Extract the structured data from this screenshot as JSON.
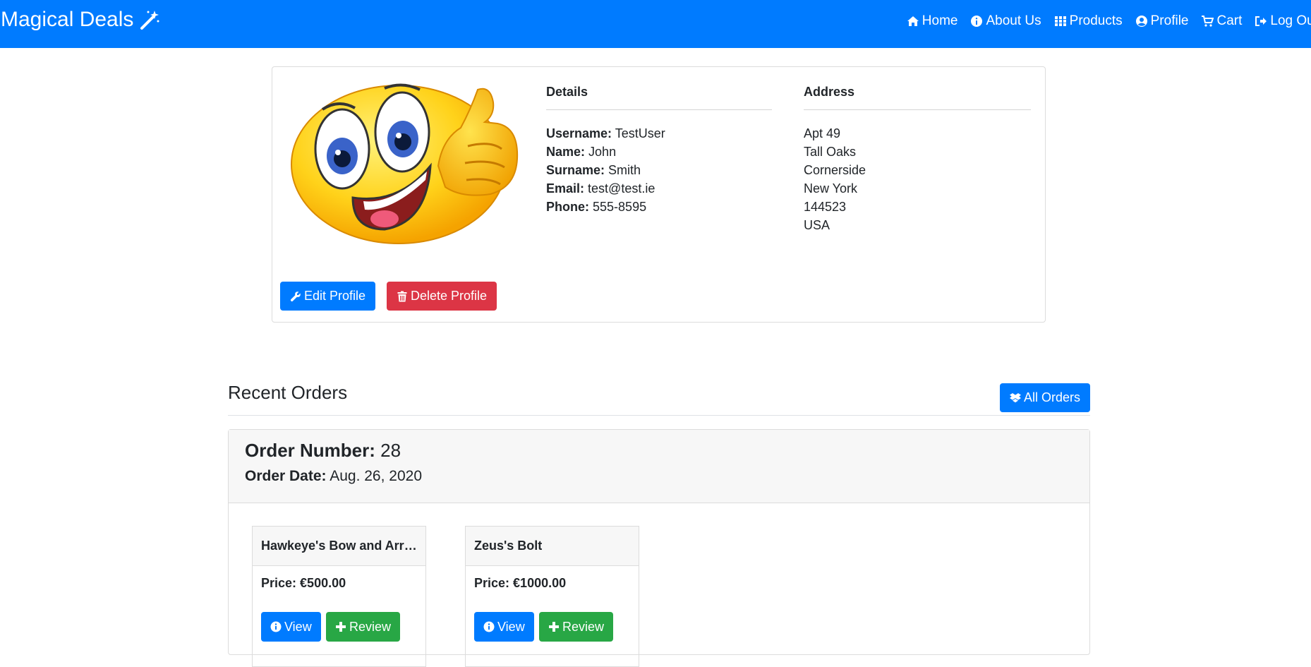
{
  "navbar": {
    "brand": "Magical Deals",
    "links": [
      {
        "label": "Home",
        "icon": "home-icon"
      },
      {
        "label": "About Us",
        "icon": "info-icon"
      },
      {
        "label": "Products",
        "icon": "grid-icon"
      },
      {
        "label": "Profile",
        "icon": "user-circle-icon"
      },
      {
        "label": "Cart",
        "icon": "cart-icon"
      },
      {
        "label": "Log Out",
        "icon": "logout-icon"
      }
    ]
  },
  "profile": {
    "details_title": "Details",
    "address_title": "Address",
    "details": [
      {
        "label": "Username:",
        "value": "TestUser"
      },
      {
        "label": "Name:",
        "value": "John"
      },
      {
        "label": "Surname:",
        "value": "Smith"
      },
      {
        "label": "Email:",
        "value": "test@test.ie"
      },
      {
        "label": "Phone:",
        "value": "555-8595"
      }
    ],
    "address_lines": [
      "Apt 49",
      "Tall Oaks",
      "Cornerside",
      "New York",
      "144523",
      "USA"
    ],
    "edit_label": "Edit Profile",
    "delete_label": "Delete Profile"
  },
  "orders": {
    "title": "Recent Orders",
    "all_orders_label": "All Orders",
    "order": {
      "number_label": "Order Number:",
      "number": "28",
      "date_label": "Order Date:",
      "date": "Aug. 26, 2020",
      "items": [
        {
          "name": "Hawkeye's Bow and Arrow",
          "price_label": "Price:",
          "price": "€500.00",
          "view_label": "View",
          "review_label": "Review"
        },
        {
          "name": "Zeus's Bolt",
          "price_label": "Price:",
          "price": "€1000.00",
          "view_label": "View",
          "review_label": "Review"
        }
      ]
    }
  },
  "colors": {
    "primary": "#007bff",
    "danger": "#dc3545",
    "success": "#28a745"
  }
}
